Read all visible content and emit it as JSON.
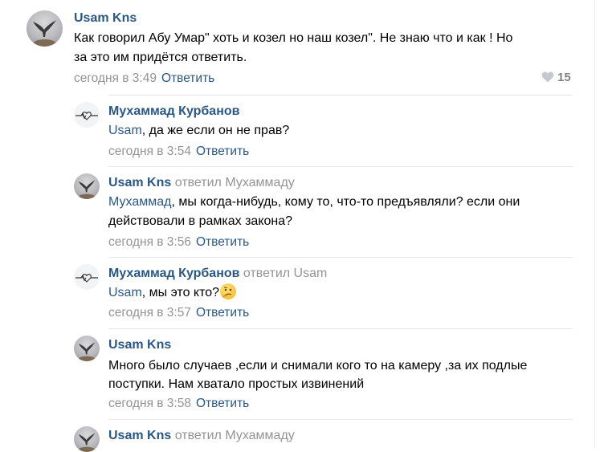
{
  "comments": [
    {
      "author": "Usam Kns",
      "replied_label": "",
      "replied_to": "",
      "mention": "",
      "lines": [
        "Как говорил Абу Умар\" хоть и козел но наш козел\". Не знаю что и как ! Но",
        "за это им придётся ответить."
      ],
      "time": "сегодня в 3:49",
      "reply": "Ответить",
      "likes": "15",
      "avatar_icon": "bird-avatar"
    },
    {
      "author": "Мухаммад Курбанов",
      "replied_label": "",
      "replied_to": "",
      "mention": "Usam",
      "lines": [
        ", да же если он не прав?"
      ],
      "time": "сегодня в 3:54",
      "reply": "Ответить",
      "avatar_icon": "heart-line-avatar"
    },
    {
      "author": "Usam Kns",
      "replied_label": "ответил",
      "replied_to": "Мухаммаду",
      "mention": "Мухаммад",
      "lines": [
        ", мы когда-нибудь, кому то, что-то предъявляли? если они",
        "действовали в рамках закона?"
      ],
      "time": "сегодня в 3:56",
      "reply": "Ответить",
      "avatar_icon": "bird-avatar"
    },
    {
      "author": "Мухаммад Курбанов",
      "replied_label": "ответил",
      "replied_to": "Usam",
      "mention": "Usam",
      "lines": [
        ", мы это кто?"
      ],
      "emoji": "thinking-face",
      "time": "сегодня в 3:57",
      "reply": "Ответить",
      "avatar_icon": "heart-line-avatar"
    },
    {
      "author": "Usam Kns",
      "replied_label": "",
      "replied_to": "",
      "mention": "",
      "lines": [
        "Много было случаев ,если и снимали кого то на камеру ,за их подлые",
        "поступки. Нам хватало простых извинений"
      ],
      "time": "сегодня в 3:58",
      "reply": "Ответить",
      "avatar_icon": "bird-avatar"
    },
    {
      "author": "Usam Kns",
      "replied_label": "ответил",
      "replied_to": "Мухаммаду",
      "mention": "",
      "lines": [],
      "time": "",
      "reply": "",
      "avatar_icon": "bird-avatar"
    }
  ],
  "colors": {
    "link": "#2a5885",
    "meta": "#939393",
    "divider": "#e7e8ec"
  }
}
